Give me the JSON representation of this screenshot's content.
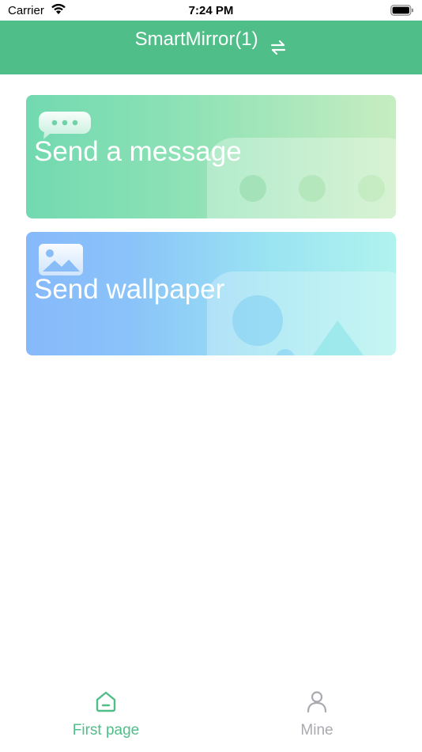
{
  "status_bar": {
    "carrier": "Carrier",
    "time": "7:24 PM"
  },
  "nav": {
    "title": "SmartMirror(1)",
    "switch_icon": "swap-arrows-icon",
    "background": "#4fbe89"
  },
  "cards": [
    {
      "label": "Send a message",
      "icon": "chat-bubble-icon",
      "colors": [
        "#72d9b0",
        "#c7edc1"
      ]
    },
    {
      "label": "Send wallpaper",
      "icon": "image-icon",
      "colors": [
        "#86b9fb",
        "#b0f3ee"
      ]
    }
  ],
  "tab_bar": {
    "items": [
      {
        "label": "First page",
        "icon": "home-icon",
        "active": true,
        "color": "#4fbe89"
      },
      {
        "label": "Mine",
        "icon": "person-icon",
        "active": false,
        "color": "#a9a9b0"
      }
    ]
  }
}
